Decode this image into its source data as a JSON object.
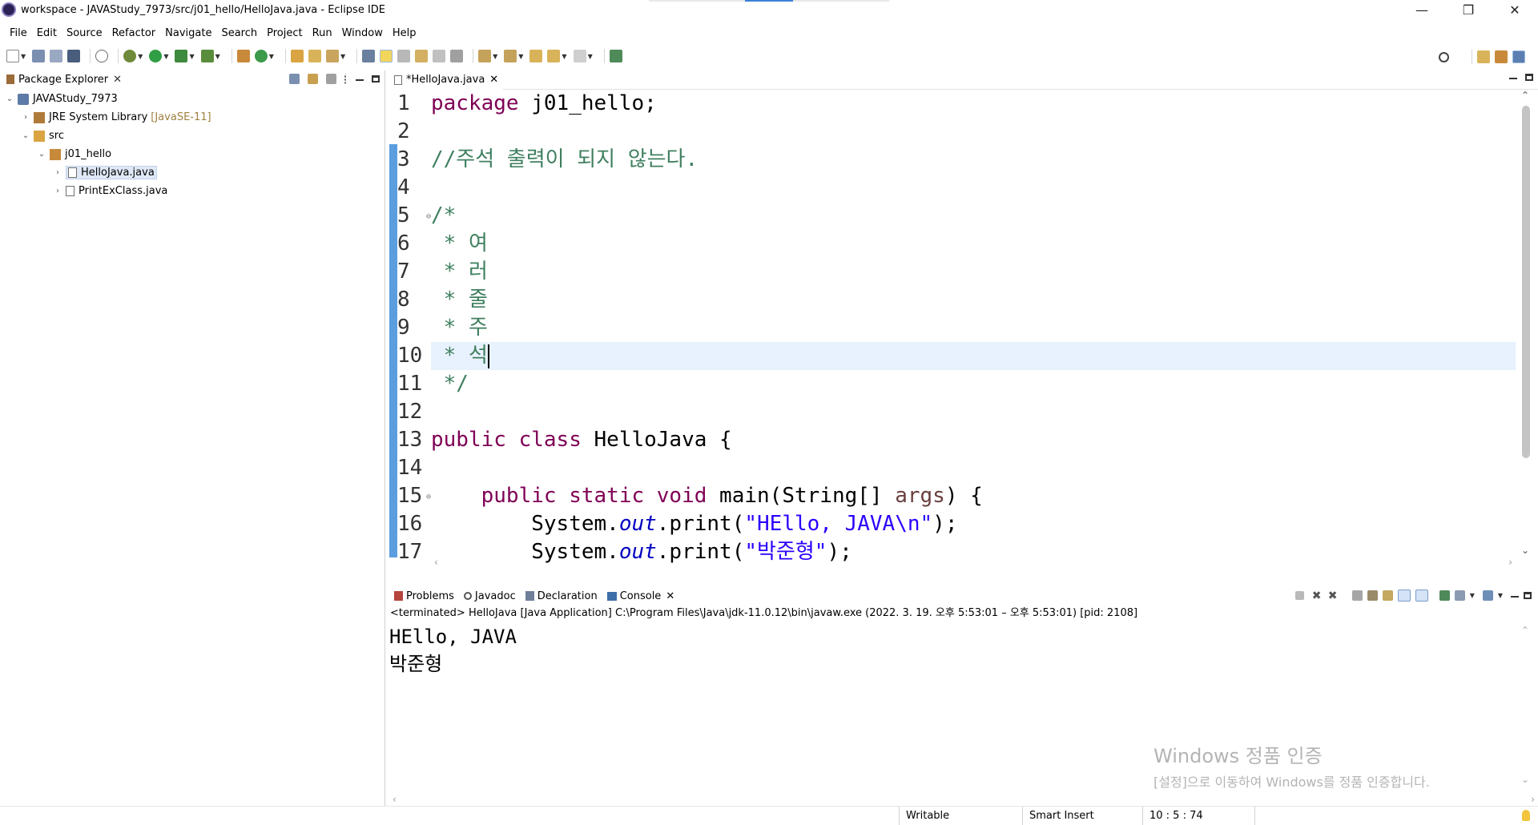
{
  "window": {
    "title": "workspace - JAVAStudy_7973/src/j01_hello/HelloJava.java - Eclipse IDE",
    "minimize": "—",
    "restore": "❐",
    "close": "✕"
  },
  "menu": [
    "File",
    "Edit",
    "Source",
    "Refactor",
    "Navigate",
    "Search",
    "Project",
    "Run",
    "Window",
    "Help"
  ],
  "package_explorer": {
    "tab_label": "Package Explorer",
    "tree": [
      {
        "label": "JAVAStudy_7973",
        "twisty": "⌄",
        "icon": "project-icon"
      },
      {
        "label": "JRE System Library",
        "tag": "[JavaSE-11]",
        "twisty": "›",
        "icon": "library-icon"
      },
      {
        "label": "src",
        "twisty": "⌄",
        "icon": "source-folder-icon"
      },
      {
        "label": "j01_hello",
        "twisty": "⌄",
        "icon": "package-icon"
      },
      {
        "label": "HelloJava.java",
        "twisty": "›",
        "icon": "java-file-icon",
        "selected": true
      },
      {
        "label": "PrintExClass.java",
        "twisty": "›",
        "icon": "java-file-icon"
      }
    ]
  },
  "editor": {
    "tab_label": "*HelloJava.java",
    "line_numbers": [
      "1",
      "2",
      "3",
      "4",
      "5",
      "6",
      "7",
      "8",
      "9",
      "10",
      "11",
      "12",
      "13",
      "14",
      "15",
      "16",
      "17"
    ],
    "current_line": 10,
    "lines": {
      "l1": {
        "kw": "package",
        "rest": " j01_hello;"
      },
      "l3": "//주석 출력이 되지 않는다.",
      "l5": "/*",
      "l6": " * 여",
      "l7": " * 러",
      "l8": " * 줄",
      "l9": " * 주",
      "l10": " * 석",
      "l11": " */",
      "l13": {
        "kw1": "public",
        "kw2": "class",
        "rest": " HelloJava {"
      },
      "l15": {
        "indent": "    ",
        "kw1": "public",
        "kw2": "static",
        "kw3": "void",
        "mid": " main(String[] ",
        "param": "args",
        "end": ") {"
      },
      "l16": {
        "indent": "        ",
        "pre": "System.",
        "field": "out",
        "mid": ".print(",
        "str": "\"HEllo, JAVA\\n\"",
        "end": ");"
      },
      "l17": {
        "indent": "        ",
        "pre": "System.",
        "field": "out",
        "mid": ".print(",
        "str": "\"박준형\"",
        "end": ");"
      }
    }
  },
  "bottom_tabs": [
    {
      "label": "Problems",
      "icon": "problems-icon"
    },
    {
      "label": "Javadoc",
      "icon": "javadoc-icon"
    },
    {
      "label": "Declaration",
      "icon": "declaration-icon"
    },
    {
      "label": "Console",
      "icon": "console-icon",
      "active": true
    }
  ],
  "console": {
    "status": "<terminated> HelloJava [Java Application] C:\\Program Files\\Java\\jdk-11.0.12\\bin\\javaw.exe  (2022. 3. 19. 오후 5:53:01 – 오후 5:53:01) [pid: 2108]",
    "output": [
      "HEllo, JAVA",
      "박준형"
    ]
  },
  "watermark": {
    "line1": "Windows 정품 인증",
    "line2": "[설정]으로 이동하여 Windows를 정품 인증합니다."
  },
  "statusbar": {
    "writable": "Writable",
    "insert_mode": "Smart Insert",
    "position": "10 : 5 : 74"
  },
  "colors": {
    "keyword": "#7f0055",
    "comment": "#3f7f5f",
    "string": "#2a00ff",
    "field": "#0000c0",
    "current_line": "#e8f2fe",
    "ruler_blue": "#5b9ee0"
  }
}
